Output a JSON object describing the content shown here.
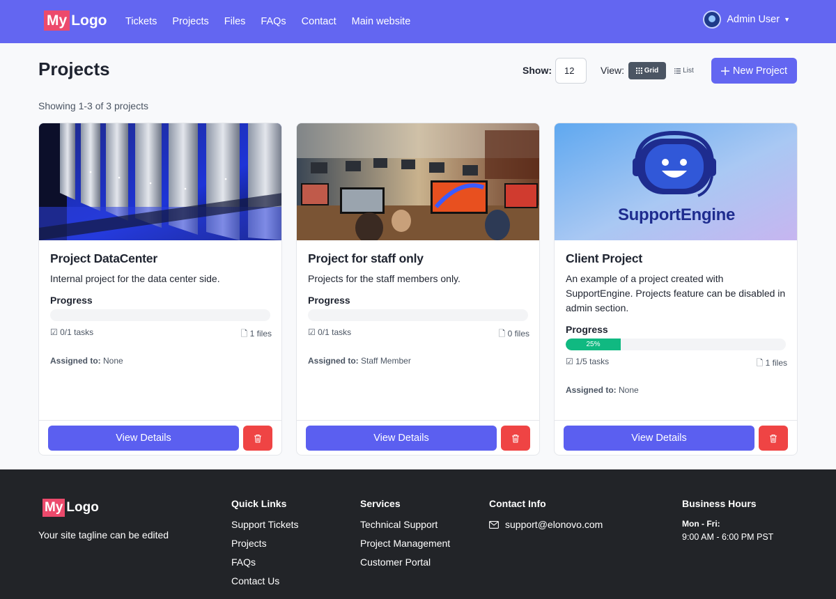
{
  "navbar": {
    "logo_my": "My",
    "logo_rest": "Logo",
    "links": [
      "Tickets",
      "Projects",
      "Files",
      "FAQs",
      "Contact",
      "Main website"
    ],
    "user_name": "Admin User"
  },
  "header": {
    "title": "Projects",
    "show_label": "Show:",
    "show_value": "12",
    "view_label": "View:",
    "view_grid": "Grid",
    "view_list": "List",
    "new_project": "New Project",
    "showing": "Showing 1-3 of 3 projects"
  },
  "projects": [
    {
      "title": "Project DataCenter",
      "description": "Internal project for the data center side.",
      "progress_label": "Progress",
      "progress": 0,
      "progress_text": "",
      "tasks": "0/1 tasks",
      "files": "1 files",
      "assigned_label": "Assigned to:",
      "assigned_value": "None",
      "view_label": "View Details",
      "image": "server-rack-image"
    },
    {
      "title": "Project for staff only",
      "description": "Projects for the staff members only.",
      "progress_label": "Progress",
      "progress": 0,
      "progress_text": "",
      "tasks": "0/1 tasks",
      "files": "0 files",
      "assigned_label": "Assigned to:",
      "assigned_value": "Staff Member",
      "view_label": "View Details",
      "image": "office-workers-image"
    },
    {
      "title": "Client Project",
      "description": "An example of a project created with SupportEngine. Projects feature can be disabled in admin section.",
      "progress_label": "Progress",
      "progress": 0.25,
      "progress_text": "25%",
      "tasks": "1/5 tasks",
      "files": "1 files",
      "assigned_label": "Assigned to:",
      "assigned_value": "None",
      "view_label": "View Details",
      "image": "supportengine-logo-image",
      "image_text": "SupportEngine"
    }
  ],
  "footer": {
    "logo_my": "My",
    "logo_rest": "Logo",
    "tagline": "Your site tagline can be edited",
    "quick_links": {
      "title": "Quick Links",
      "items": [
        "Support Tickets",
        "Projects",
        "FAQs",
        "Contact Us"
      ]
    },
    "services": {
      "title": "Services",
      "items": [
        "Technical Support",
        "Project Management",
        "Customer Portal"
      ]
    },
    "contact": {
      "title": "Contact Info",
      "email": "support@elonovo.com"
    },
    "hours": {
      "title": "Business Hours",
      "days": "Mon - Fri:",
      "time": "9:00 AM - 6:00 PM PST"
    }
  },
  "colors": {
    "primary": "#6366f1",
    "danger": "#ef4444",
    "success": "#10b981",
    "footer_bg": "#222428",
    "logo_accent": "#ec4a6c"
  }
}
